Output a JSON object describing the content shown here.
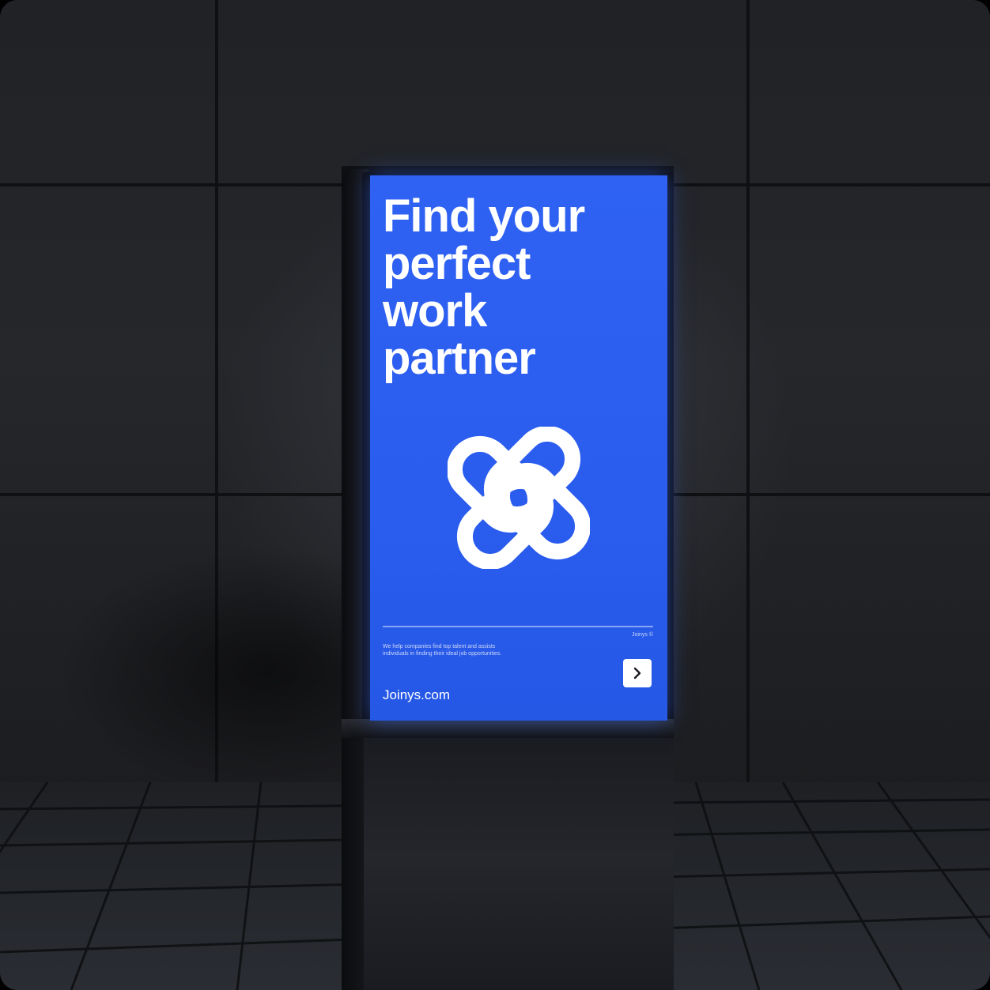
{
  "poster": {
    "headline": [
      "Find your",
      "perfect",
      "work",
      "partner"
    ],
    "tagline": "We help companies find top talent and assists individuals in finding their ideal job opportunities.",
    "year": "Joinys ©",
    "website": "Joinys.com"
  },
  "icons": {
    "logo": "interlocking-link-logo-icon",
    "arrow": "chevron-right-icon"
  },
  "colors": {
    "screen_blue": "#2f62f2",
    "wall": "#222428",
    "floor_glow": "#aee1f0"
  }
}
